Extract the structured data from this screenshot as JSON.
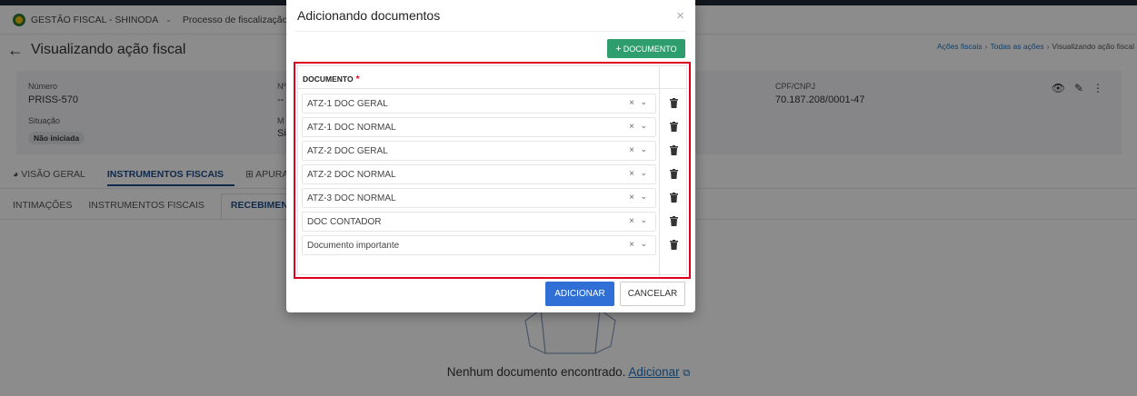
{
  "topbar": {
    "org_name": "GESTÃO FISCAL - SHINODA",
    "process_name": "Processo de fiscalização ISS"
  },
  "page": {
    "title": "Visualizando ação fiscal",
    "breadcrumb": [
      "Ações fiscais",
      "Todas as ações",
      "Visualizando ação fiscal"
    ]
  },
  "info": {
    "numero_label": "Número",
    "numero_value": "PRISS-570",
    "n_label": "Nº",
    "n_value": "--",
    "situacao_label": "Situação",
    "situacao_value": "Não iniciada",
    "m_label": "M",
    "m_value": "Si",
    "cpf_label": "CPF/CNPJ",
    "cpf_value": "70.187.208/0001-47"
  },
  "tabs": [
    {
      "label": "VISÃO GERAL"
    },
    {
      "label": "INSTRUMENTOS FISCAIS"
    },
    {
      "label": "APURA"
    }
  ],
  "subtabs": [
    {
      "label": "INTIMAÇÕES"
    },
    {
      "label": "INSTRUMENTOS FISCAIS"
    },
    {
      "label": "RECEBIMENT"
    }
  ],
  "empty_state": {
    "text": "Nenhum documento encontrado.",
    "link": "Adicionar"
  },
  "modal": {
    "title": "Adicionando documentos",
    "close_symbol": "×",
    "add_document_button": "DOCUMENTO",
    "add_document_plus": "+",
    "column_header": "DOCUMENTO",
    "required_mark": "*",
    "rows": [
      "ATZ-1 DOC GERAL",
      "ATZ-1 DOC NORMAL",
      "ATZ-2 DOC GERAL",
      "ATZ-2 DOC NORMAL",
      "ATZ-3 DOC NORMAL",
      "DOC CONTADOR",
      "Documento importante"
    ],
    "submit_button": "ADICIONAR",
    "cancel_button": "CANCELAR"
  },
  "colors": {
    "accent_green": "#2e9e6e",
    "primary_blue": "#2f6fd6",
    "highlight_red": "#e0001b"
  },
  "icons": {
    "back": "back-arrow-icon",
    "close": "close-icon",
    "clear": "clear-icon",
    "chevron": "chevron-down-icon",
    "delete": "trash-icon",
    "view": "eye-icon",
    "edit": "pencil-icon",
    "more": "more-vertical-icon"
  }
}
